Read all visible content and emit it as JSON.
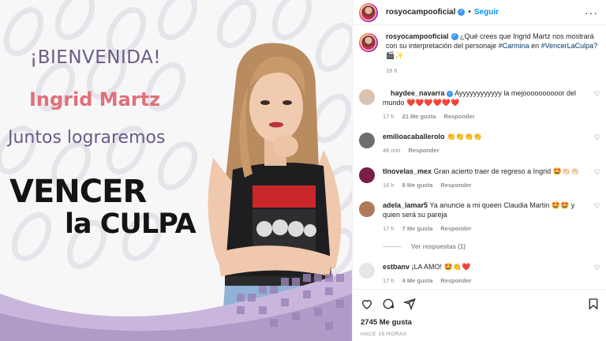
{
  "post": {
    "image": {
      "welcome": "¡BIENVENIDA!",
      "guest_name": "Ingrid Martz",
      "tagline": "Juntos lograremos",
      "show_title_line1": "VENCER",
      "show_title_line2": "la CULPA"
    }
  },
  "header": {
    "username": "rosyocampooficial",
    "separator": "•",
    "follow_label": "Seguir",
    "more_icon": "more-horizontal-icon",
    "more_label": "···"
  },
  "caption": {
    "username": "rosyocampooficial",
    "text_before": " ¿Qué crees que Ingrid Martz nos mostrará con su interpretación del personaje ",
    "hashtag1": "#Carmina",
    "text_mid": " en ",
    "hashtag2": "#VencerLaCulpa",
    "text_after": "? 🎬✨",
    "time": "18 h"
  },
  "comments": [
    {
      "username": "haydee_navarra",
      "verified": true,
      "text": " Ayyyyyyyyyyyy la mejoooooooooor del mundo ❤️❤️❤️❤️❤️❤️",
      "time": "17 h",
      "likes": "21 Me gusta",
      "reply": "Responder",
      "avatar_color": "#d9c2b0"
    },
    {
      "username": "emilioacaballerolo",
      "verified": false,
      "text": " 👏👏👏👏",
      "time": "48 min",
      "likes": "",
      "reply": "Responder",
      "avatar_color": "#6e6e6e"
    },
    {
      "username": "tlnovelas_mex",
      "verified": false,
      "text": " Gran acierto traer de regreso a Ingrid 🤩👏🏻👏🏻",
      "time": "16 h",
      "likes": "8 Me gusta",
      "reply": "Responder",
      "avatar_color": "#7a1f4a"
    },
    {
      "username": "adela_lamar5",
      "verified": false,
      "text": " Ya anuncie a mi queen Claudia Martin 🤩🤩 y quien será su pareja",
      "time": "17 h",
      "likes": "7 Me gusta",
      "reply": "Responder",
      "avatar_color": "#b07a5a"
    },
    {
      "username": "estbanv",
      "verified": false,
      "text": " ¡LA AMO! 🤩👏❤️",
      "time": "17 h",
      "likes": "4 Me gusta",
      "reply": "Responder",
      "avatar_color": "#e6e6e6"
    }
  ],
  "view_replies": "Ver respuestas (1)",
  "actions": {
    "likes_count": "2745 Me gusta",
    "post_time": "HACE 18 HORAS",
    "icons": [
      "heart-icon",
      "comment-icon",
      "share-icon",
      "save-icon"
    ]
  },
  "colors": {
    "accent": "#0095f6",
    "verified": "#3897f0",
    "title_purple": "#6b5a86",
    "name_pink": "#e0707a"
  }
}
